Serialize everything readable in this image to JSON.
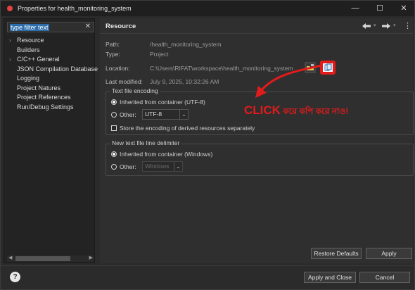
{
  "window": {
    "title": "Properties for health_monitoring_system",
    "minimize_symbol": "—",
    "maximize_symbol": "☐",
    "close_symbol": "✕"
  },
  "sidebar": {
    "filter_text": "type filter text",
    "clear_symbol": "✕",
    "items": [
      {
        "label": "Resource",
        "expandable": true
      },
      {
        "label": "Builders",
        "expandable": false
      },
      {
        "label": "C/C++ General",
        "expandable": true
      },
      {
        "label": "JSON Compilation Database",
        "expandable": false
      },
      {
        "label": "Logging",
        "expandable": false
      },
      {
        "label": "Project Natures",
        "expandable": false
      },
      {
        "label": "Project References",
        "expandable": false
      },
      {
        "label": "Run/Debug Settings",
        "expandable": false
      }
    ]
  },
  "resource": {
    "title": "Resource",
    "path_label": "Path:",
    "path_value": "/health_monitoring_system",
    "type_label": "Type:",
    "type_value": "Project",
    "location_label": "Location:",
    "location_value": "C:\\Users\\RIFAT\\workspace\\health_monitoring_system",
    "modified_label": "Last modified:",
    "modified_value": "July 9, 2025, 10:32:26 AM"
  },
  "encoding": {
    "legend": "Text file encoding",
    "inherited_label": "Inherited from container (UTF-8)",
    "other_label": "Other:",
    "other_value": "UTF-8",
    "store_label": "Store the encoding of derived resources separately"
  },
  "delimiter": {
    "legend": "New text file line delimiter",
    "inherited_label": "Inherited from container (Windows)",
    "other_label": "Other:",
    "other_value": "Windows"
  },
  "annotation": {
    "click": "CLICK",
    "rest": " করে কপি করে নাও!"
  },
  "buttons": {
    "restore": "Restore Defaults",
    "apply": "Apply",
    "apply_close": "Apply and Close",
    "cancel": "Cancel",
    "help": "?"
  },
  "colors": {
    "annotation_red": "#e21b1b",
    "selection_blue": "#2c6ca8"
  },
  "icons": [
    "app-icon",
    "back-arrow-icon",
    "forward-arrow-icon",
    "menu-dots-icon",
    "open-folder-icon",
    "copy-icon",
    "help-icon",
    "red-curved-arrow-icon"
  ]
}
